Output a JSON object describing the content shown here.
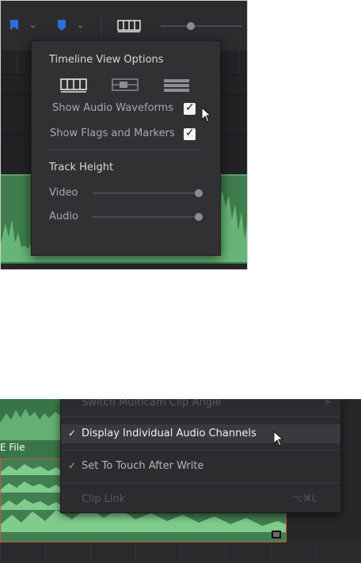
{
  "top_panel": {
    "popup": {
      "title": "Timeline View Options",
      "show_audio_waveforms_label": "Show Audio Waveforms",
      "show_audio_waveforms_checked": true,
      "show_flags_markers_label": "Show Flags and Markers",
      "show_flags_markers_checked": true,
      "track_height_title": "Track Height",
      "video_label": "Video",
      "video_level": 1.0,
      "audio_label": "Audio",
      "audio_level": 1.0,
      "check_glyph": "✓"
    },
    "toolbar": {
      "zoom_level": 0.37,
      "flag_color": "#2a6edc",
      "marker_color": "#2a6edc"
    }
  },
  "bottom_panel": {
    "clip_label": "E File",
    "menu": {
      "items": [
        {
          "label": "Switch Multicam Clip Angle",
          "checked": false,
          "shortcut": "",
          "enabled": false,
          "submenu_arrow": ">"
        },
        {
          "label": "Display Individual Audio Channels",
          "checked": true,
          "shortcut": "",
          "enabled": true,
          "highlighted": true
        },
        {
          "label": "Set To Touch After Write",
          "checked": true,
          "shortcut": "",
          "enabled": true
        },
        {
          "label": "Clip Link",
          "checked": false,
          "shortcut": "⌥⌘L",
          "enabled": false
        }
      ],
      "check_glyph": "✓"
    }
  },
  "colors": {
    "clip_green": "#3f7d4d",
    "waveform_green": "#6fbf7f",
    "clip_border_red": "#c45a4b",
    "accent_blue": "#2a6edc"
  }
}
